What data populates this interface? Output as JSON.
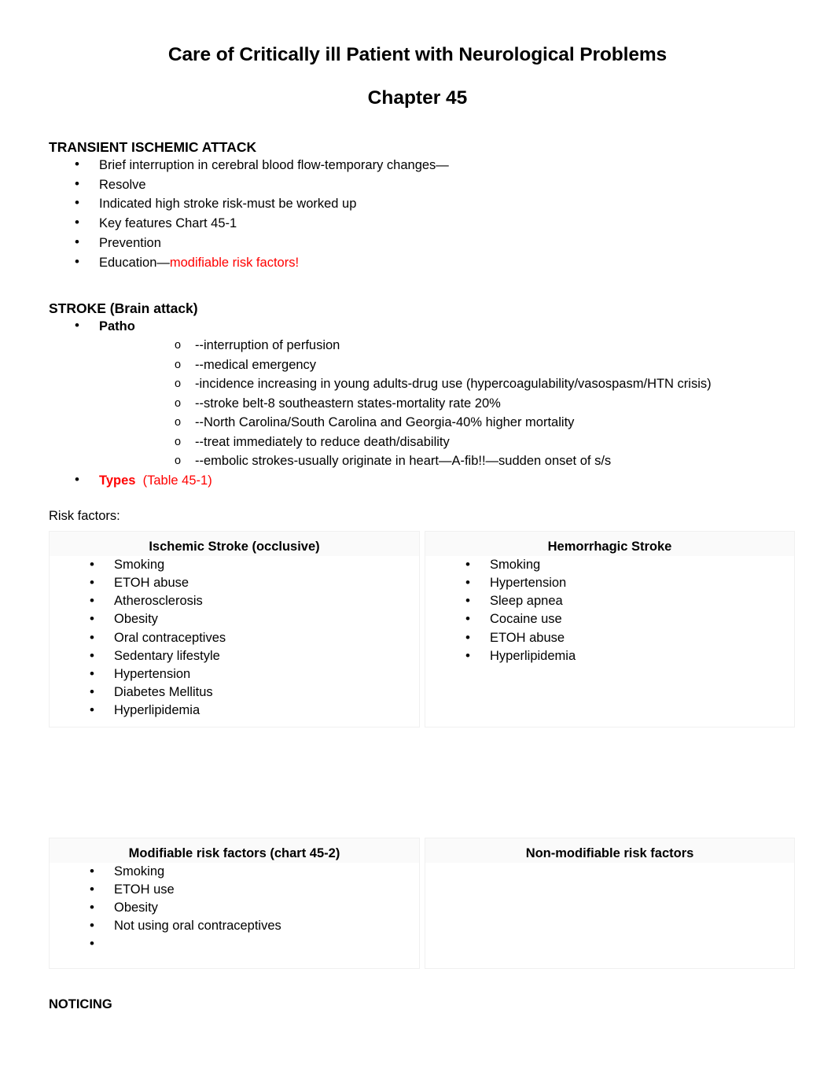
{
  "document": {
    "title": "Care of Critically ill Patient with Neurological Problems",
    "subtitle": "Chapter 45"
  },
  "sections": {
    "tia": {
      "heading": "TRANSIENT ISCHEMIC ATTACK",
      "bullets": [
        "Brief interruption in cerebral blood flow-temporary changes—",
        "Resolve",
        "Indicated high stroke risk-must be worked up",
        "Key features Chart 45-1",
        "Prevention"
      ],
      "education_prefix": "Education—",
      "education_highlight": "modifiable risk factors!"
    },
    "stroke": {
      "heading": "STROKE (Brain attack)",
      "patho_label": "Patho",
      "patho_items": [
        "--interruption of perfusion",
        "--medical emergency",
        "-incidence increasing in young adults-drug use (hypercoagulability/vasospasm/HTN crisis)",
        "--stroke belt-8 southeastern states-mortality rate 20%",
        "--North Carolina/South Carolina and Georgia-40% higher mortality",
        "--treat immediately to reduce death/disability",
        "--embolic strokes-usually originate in heart—A-fib!!—sudden onset of s/s"
      ],
      "types_label": "Types",
      "types_reference": "(Table 45-1)"
    }
  },
  "risk_factors_label": "Risk factors:",
  "table_stroke_types": {
    "left_header": "Ischemic Stroke (occlusive)",
    "right_header": "Hemorrhagic Stroke",
    "left_items": [
      "Smoking",
      "ETOH abuse",
      "Atherosclerosis",
      "Obesity",
      "Oral contraceptives",
      "Sedentary lifestyle",
      "Hypertension",
      "Diabetes Mellitus",
      "Hyperlipidemia"
    ],
    "right_items": [
      "Smoking",
      "Hypertension",
      "Sleep apnea",
      "Cocaine use",
      "ETOH abuse",
      "Hyperlipidemia"
    ]
  },
  "table_modifiable": {
    "left_header": "Modifiable risk factors (chart 45-2)",
    "right_header": "Non-modifiable risk factors",
    "left_items": [
      "Smoking",
      "ETOH use",
      "Obesity",
      "Not using oral contraceptives",
      ""
    ],
    "right_items": []
  },
  "footer_heading": "NOTICING",
  "colors": {
    "text": "#000000",
    "highlight_red": "#FF0000",
    "table_border": "#F0F0F0",
    "cell_header_bg": "#FAFAFA"
  }
}
